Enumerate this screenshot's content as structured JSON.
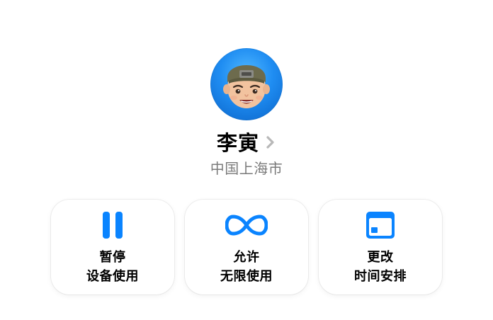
{
  "profile": {
    "name": "李寅",
    "location": "中国上海市"
  },
  "actions": [
    {
      "line1": "暂停",
      "line2": "设备使用",
      "icon": "pause-icon"
    },
    {
      "line1": "允许",
      "line2": "无限使用",
      "icon": "infinity-icon"
    },
    {
      "line1": "更改",
      "line2": "时间安排",
      "icon": "calendar-window-icon"
    }
  ],
  "colors": {
    "accent": "#0A84FF",
    "secondary_text": "#7A7A7A",
    "chevron": "#B8B8B8",
    "avatar_background": "#1F8DF2"
  }
}
